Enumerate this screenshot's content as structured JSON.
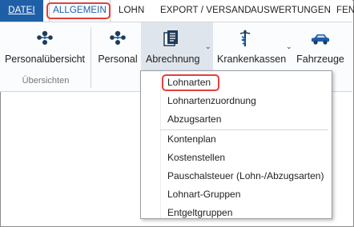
{
  "menu": {
    "tabs": [
      {
        "label": "DATEI"
      },
      {
        "label": "ALLGEMEIN"
      },
      {
        "label": "LOHN"
      },
      {
        "label": "EXPORT / VERSAND"
      },
      {
        "label": "AUSWERTUNGEN"
      },
      {
        "label": "FEN"
      }
    ]
  },
  "ribbon": {
    "buttons": [
      {
        "label": "Personalübersicht",
        "icon": "people-group-icon"
      },
      {
        "label": "Personal",
        "icon": "people-group-icon"
      },
      {
        "label": "Abrechnung",
        "icon": "documents-icon"
      },
      {
        "label": "Krankenkassen",
        "icon": "caduceus-icon"
      },
      {
        "label": "Fahrzeuge",
        "icon": "car-icon"
      }
    ],
    "group_label": "Übersichten"
  },
  "dropdown": {
    "items": [
      {
        "label": "Lohnarten"
      },
      {
        "label": "Lohnartenzuordnung"
      },
      {
        "label": "Abzugsarten"
      },
      {
        "label": "Kontenplan"
      },
      {
        "label": "Kostenstellen"
      },
      {
        "label": "Pauschalsteuer (Lohn-/Abzugsarten)"
      },
      {
        "label": "Lohnart-Gruppen"
      },
      {
        "label": "Entgeltgruppen"
      }
    ]
  },
  "colors": {
    "accent": "#1f5fa8",
    "highlight": "#e0413a",
    "icon_dark": "#1f3b57"
  }
}
